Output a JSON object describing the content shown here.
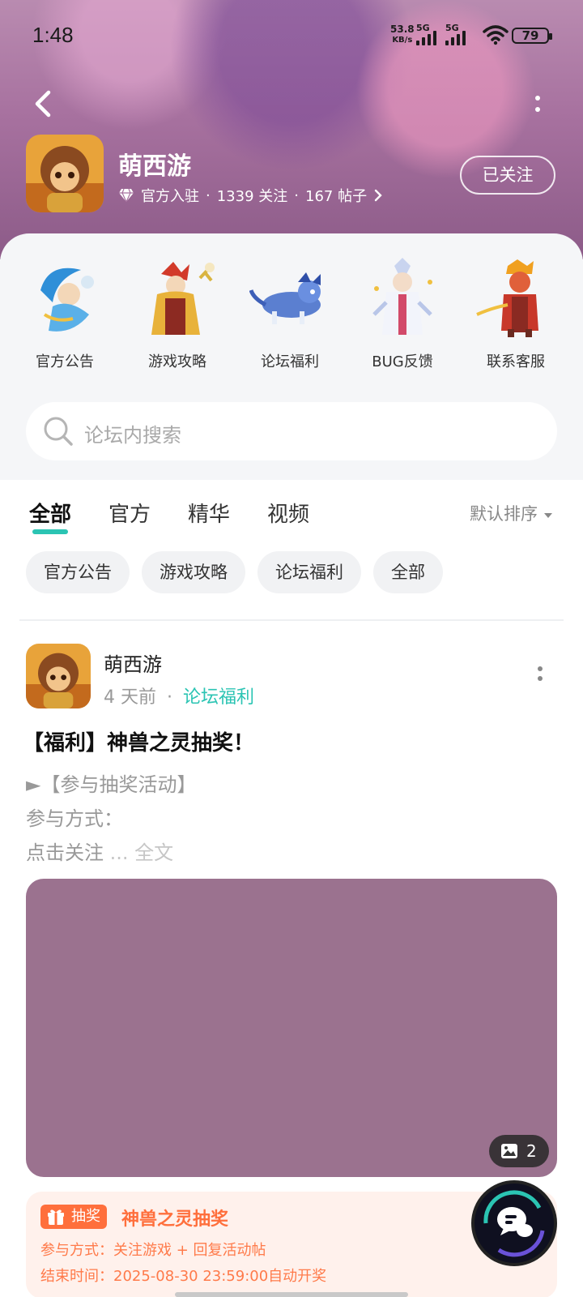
{
  "status_bar": {
    "time": "1:48",
    "net_speed": "53.8",
    "net_unit": "KB/s",
    "sim1": "5G",
    "sim2": "5G",
    "battery": "79"
  },
  "header": {
    "title": "萌西游",
    "official": "官方入驻",
    "followers": "1339 关注",
    "posts": "167 帖子",
    "follow_label": "已关注",
    "sep": "·"
  },
  "categories": [
    {
      "label": "官方公告",
      "icon": "announcement-character-icon"
    },
    {
      "label": "游戏攻略",
      "icon": "guide-character-icon"
    },
    {
      "label": "论坛福利",
      "icon": "welfare-beast-icon"
    },
    {
      "label": "BUG反馈",
      "icon": "bug-character-icon"
    },
    {
      "label": "联系客服",
      "icon": "support-character-icon"
    }
  ],
  "search": {
    "placeholder": "论坛内搜索"
  },
  "tabs": [
    {
      "label": "全部",
      "active": true
    },
    {
      "label": "官方"
    },
    {
      "label": "精华"
    },
    {
      "label": "视频"
    }
  ],
  "sort_label": "默认排序",
  "filters": [
    "官方公告",
    "游戏攻略",
    "论坛福利",
    "全部"
  ],
  "post": {
    "author": "萌西游",
    "time": "4 天前",
    "sep": "·",
    "tag": "论坛福利",
    "title": "【福利】神兽之灵抽奖！",
    "line1": "►【参与抽奖活动】",
    "line2": "参与方式：",
    "line3": "点击关注",
    "ellipsis": "...",
    "full_text": "全文",
    "image_count": "2",
    "image_color": "#9b728f"
  },
  "lottery": {
    "badge": "抽奖",
    "title": "神兽之灵抽奖",
    "method": "参与方式：关注游戏 + 回复活动帖",
    "end_time": "结束时间：2025-08-30 23:59:00自动开奖"
  },
  "colors": {
    "accent": "#2bc4b3",
    "lottery": "#ff6f3c"
  }
}
